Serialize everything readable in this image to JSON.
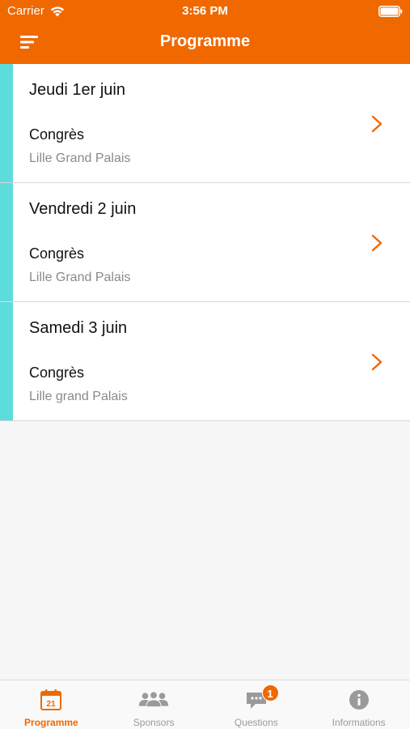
{
  "status_bar": {
    "carrier": "Carrier",
    "time": "3:56 PM"
  },
  "nav": {
    "title": "Programme",
    "menu_icon": "menu-icon"
  },
  "colors": {
    "brand": "#f06800",
    "accent": "#5ddcdc"
  },
  "sessions": [
    {
      "day": "Jeudi 1er juin",
      "type": "Congrès",
      "place": "Lille Grand Palais"
    },
    {
      "day": "Vendredi 2 juin",
      "type": "Congrès",
      "place": "Lille Grand Palais"
    },
    {
      "day": "Samedi 3 juin",
      "type": "Congrès",
      "place": "Lille grand Palais"
    }
  ],
  "tabs": [
    {
      "label": "Programme",
      "icon": "calendar-icon",
      "icon_text": "21",
      "active": true
    },
    {
      "label": "Sponsors",
      "icon": "people-icon",
      "active": false
    },
    {
      "label": "Questions",
      "icon": "chat-icon",
      "badge": "1",
      "active": false
    },
    {
      "label": "Informations",
      "icon": "info-icon",
      "active": false
    }
  ]
}
